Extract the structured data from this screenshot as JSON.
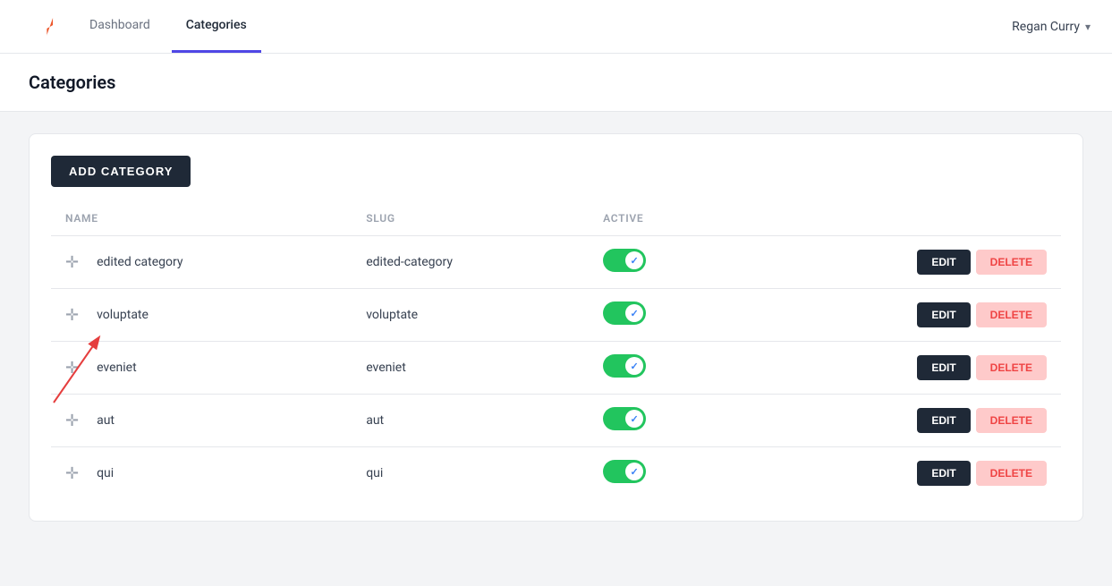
{
  "app": {
    "logo_label": "Laravel",
    "nav": {
      "items": [
        {
          "label": "Dashboard",
          "active": false
        },
        {
          "label": "Categories",
          "active": true
        }
      ]
    },
    "user": {
      "name": "Regan Curry"
    }
  },
  "page": {
    "title": "Categories"
  },
  "toolbar": {
    "add_button_label": "ADD CATEGORY"
  },
  "table": {
    "headers": [
      {
        "key": "name",
        "label": "NAME"
      },
      {
        "key": "slug",
        "label": "SLUG"
      },
      {
        "key": "active",
        "label": "ACTIVE"
      },
      {
        "key": "actions",
        "label": ""
      }
    ],
    "rows": [
      {
        "id": 1,
        "name": "edited category",
        "slug": "edited-category",
        "active": true
      },
      {
        "id": 2,
        "name": "voluptate",
        "slug": "voluptate",
        "active": true
      },
      {
        "id": 3,
        "name": "eveniet",
        "slug": "eveniet",
        "active": true
      },
      {
        "id": 4,
        "name": "aut",
        "slug": "aut",
        "active": true
      },
      {
        "id": 5,
        "name": "qui",
        "slug": "qui",
        "active": true
      }
    ],
    "edit_label": "EDIT",
    "delete_label": "DELETE"
  },
  "colors": {
    "active_toggle": "#22c55e",
    "nav_active_border": "#4f46e5",
    "edit_btn_bg": "#1f2937",
    "delete_btn_bg": "#fecaca",
    "delete_btn_color": "#ef4444"
  }
}
